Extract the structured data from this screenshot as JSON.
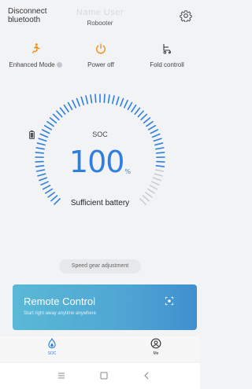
{
  "header": {
    "disconnect_label": "Disconnect bluetooth",
    "device_title": "Name User",
    "device_subtitle": "Robooter",
    "settings_icon": "gear-icon"
  },
  "actions": [
    {
      "label": "Enhanced Mode",
      "icon": "running-person-icon",
      "color": "#f08c1a"
    },
    {
      "label": "Power off",
      "icon": "power-icon",
      "color": "#f08c1a"
    },
    {
      "label": "Fold controll",
      "icon": "wheelchair-fold-icon",
      "color": "#333333"
    }
  ],
  "battery": {
    "soc_label": "SOC",
    "soc_value": "100",
    "soc_unit": "%",
    "status": "Sufficient battery",
    "level": 1.0
  },
  "speed_gear": {
    "label": "Speed gear adjustment"
  },
  "remote": {
    "title": "Remote Control",
    "subtitle": "Start right away anytime anywhere",
    "icon": "target-icon"
  },
  "tabs": [
    {
      "label": "SOC",
      "icon": "drop-icon",
      "active": true
    },
    {
      "label": "Me",
      "icon": "user-icon",
      "active": false
    }
  ],
  "system_nav": [
    "menu-icon",
    "home-square-icon",
    "back-chevron-icon"
  ],
  "colors": {
    "accent": "#2f7fe0",
    "orange": "#f08c1a",
    "banner": "#4fa6d3"
  }
}
